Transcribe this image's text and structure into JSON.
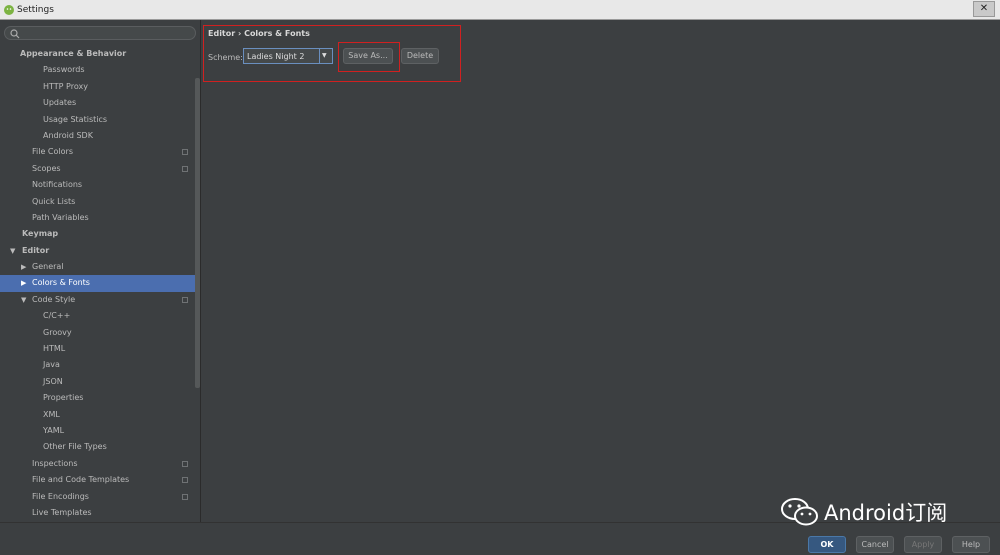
{
  "window": {
    "title": "Settings",
    "close_label": "✕"
  },
  "search": {
    "placeholder": ""
  },
  "sidebar": {
    "items": [
      {
        "label": "Appearance & Behavior",
        "level": 0,
        "bold": true,
        "arrow": ""
      },
      {
        "label": "Passwords",
        "level": 2
      },
      {
        "label": "HTTP Proxy",
        "level": 2
      },
      {
        "label": "Updates",
        "level": 2
      },
      {
        "label": "Usage Statistics",
        "level": 2
      },
      {
        "label": "Android SDK",
        "level": 2
      },
      {
        "label": "File Colors",
        "level": 1,
        "config": true
      },
      {
        "label": "Scopes",
        "level": 1,
        "config": true
      },
      {
        "label": "Notifications",
        "level": 1
      },
      {
        "label": "Quick Lists",
        "level": 1
      },
      {
        "label": "Path Variables",
        "level": 1
      },
      {
        "label": "Keymap",
        "level": 0,
        "bold": true
      },
      {
        "label": "Editor",
        "level": 0,
        "bold": true,
        "arrow": "down"
      },
      {
        "label": "General",
        "level": 1,
        "arrow": "right"
      },
      {
        "label": "Colors & Fonts",
        "level": 1,
        "arrow": "right",
        "selected": true
      },
      {
        "label": "Code Style",
        "level": 1,
        "arrow": "down",
        "config": true
      },
      {
        "label": "C/C++",
        "level": 2
      },
      {
        "label": "Groovy",
        "level": 2
      },
      {
        "label": "HTML",
        "level": 2
      },
      {
        "label": "Java",
        "level": 2
      },
      {
        "label": "JSON",
        "level": 2
      },
      {
        "label": "Properties",
        "level": 2
      },
      {
        "label": "XML",
        "level": 2
      },
      {
        "label": "YAML",
        "level": 2
      },
      {
        "label": "Other File Types",
        "level": 2
      },
      {
        "label": "Inspections",
        "level": 1,
        "config": true
      },
      {
        "label": "File and Code Templates",
        "level": 1,
        "config": true
      },
      {
        "label": "File Encodings",
        "level": 1,
        "config": true
      },
      {
        "label": "Live Templates",
        "level": 1
      }
    ]
  },
  "content": {
    "breadcrumb": "Editor › Colors & Fonts",
    "scheme_label": "Scheme:",
    "scheme_value": "Ladies Night 2",
    "save_as_label": "Save As...",
    "delete_label": "Delete"
  },
  "footer": {
    "ok_label": "OK",
    "cancel_label": "Cancel",
    "apply_label": "Apply",
    "help_label": "Help"
  },
  "watermark": {
    "text": "Android订阅"
  },
  "colors": {
    "accent": "#4b6eaf",
    "highlight_box": "#d02020",
    "background": "#3c3f41"
  }
}
